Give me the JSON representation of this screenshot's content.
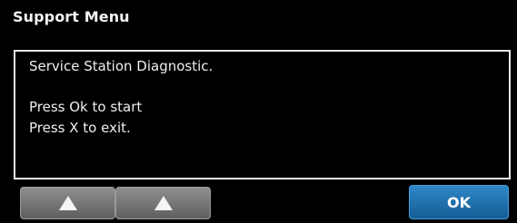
{
  "window": {
    "title": "Support Menu"
  },
  "message": {
    "lines": [
      "Service Station Diagnostic.",
      "Press Ok to start",
      "Press X to exit."
    ]
  },
  "footer": {
    "buttons": [
      {
        "icon": "triangle-up-icon"
      },
      {
        "icon": "triangle-up-icon"
      }
    ],
    "ok_label": "OK"
  },
  "colors": {
    "background": "#000000",
    "border": "#e6e6e6",
    "button_gray": "#7a7a7a",
    "button_blue": "#1f73b5",
    "text": "#ffffff"
  }
}
